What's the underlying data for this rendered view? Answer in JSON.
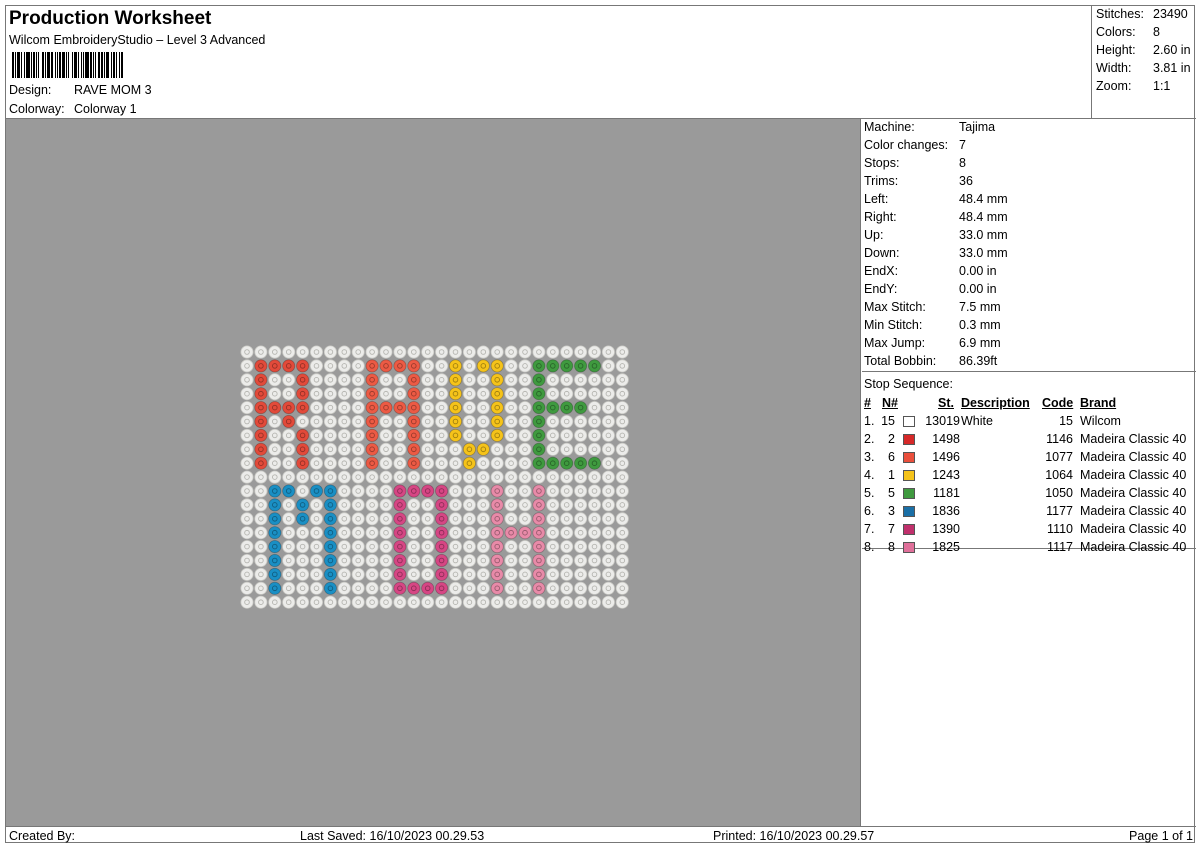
{
  "header": {
    "title": "Production Worksheet",
    "subtitle": "Wilcom EmbroideryStudio – Level 3 Advanced",
    "design_label": "Design:",
    "design_value": "RAVE MOM 3",
    "colorway_label": "Colorway:",
    "colorway_value": "Colorway 1"
  },
  "summary": [
    {
      "label": "Stitches:",
      "value": "23490"
    },
    {
      "label": "Colors:",
      "value": "8"
    },
    {
      "label": "Height:",
      "value": "2.60 in"
    },
    {
      "label": "Width:",
      "value": "3.81 in"
    },
    {
      "label": "Zoom:",
      "value": "1:1"
    }
  ],
  "machine_info": [
    {
      "label": "Machine:",
      "value": "Tajima"
    },
    {
      "label": "Color changes:",
      "value": "7"
    },
    {
      "label": "Stops:",
      "value": "8"
    },
    {
      "label": "Trims:",
      "value": "36"
    },
    {
      "label": "Left:",
      "value": "48.4 mm"
    },
    {
      "label": "Right:",
      "value": "48.4 mm"
    },
    {
      "label": "Up:",
      "value": "33.0 mm"
    },
    {
      "label": "Down:",
      "value": "33.0 mm"
    },
    {
      "label": "EndX:",
      "value": "0.00 in"
    },
    {
      "label": "EndY:",
      "value": "0.00 in"
    },
    {
      "label": "Max Stitch:",
      "value": "7.5 mm"
    },
    {
      "label": "Min Stitch:",
      "value": "0.3 mm"
    },
    {
      "label": "Max Jump:",
      "value": "6.9 mm"
    },
    {
      "label": "Total Bobbin:",
      "value": "86.39ft"
    }
  ],
  "stop_sequence": {
    "title": "Stop Sequence:",
    "headers": {
      "index": "#",
      "needle": "N#",
      "stitches": "St.",
      "description": "Description",
      "code": "Code",
      "brand": "Brand"
    },
    "rows": [
      {
        "index": "1.",
        "needle": "15",
        "color": "#ffffff",
        "stitches": "13019",
        "description": "White",
        "code": "15",
        "brand": "Wilcom"
      },
      {
        "index": "2.",
        "needle": "2",
        "color": "#d62828",
        "stitches": "1498",
        "description": "",
        "code": "1146",
        "brand": "Madeira Classic 40"
      },
      {
        "index": "3.",
        "needle": "6",
        "color": "#ea4f3c",
        "stitches": "1496",
        "description": "",
        "code": "1077",
        "brand": "Madeira Classic 40"
      },
      {
        "index": "4.",
        "needle": "1",
        "color": "#f5c31a",
        "stitches": "1243",
        "description": "",
        "code": "1064",
        "brand": "Madeira Classic 40"
      },
      {
        "index": "5.",
        "needle": "5",
        "color": "#3f9a3f",
        "stitches": "1181",
        "description": "",
        "code": "1050",
        "brand": "Madeira Classic 40"
      },
      {
        "index": "6.",
        "needle": "3",
        "color": "#1a6fa6",
        "stitches": "1836",
        "description": "",
        "code": "1177",
        "brand": "Madeira Classic 40"
      },
      {
        "index": "7.",
        "needle": "7",
        "color": "#c0306c",
        "stitches": "1390",
        "description": "",
        "code": "1110",
        "brand": "Madeira Classic 40"
      },
      {
        "index": "8.",
        "needle": "8",
        "color": "#e0709a",
        "stitches": "1825",
        "description": "",
        "code": "1117",
        "brand": "Madeira Classic 40"
      }
    ]
  },
  "footer": {
    "created_by": "Created By:",
    "last_saved": "Last Saved: 16/10/2023 00.29.53",
    "printed": "Printed: 16/10/2023 00.29.57",
    "page": "Page 1 of 1"
  },
  "design_colors": {
    "background": "#9a9a9a",
    "white": "#ececea",
    "r_letter": "#e24a3a",
    "a_letter": "#ec5a44",
    "v_letter": "#f5c31a",
    "e_letter": "#3f9a3f",
    "m1_letter": "#1a8fc4",
    "o_letter": "#d64684",
    "m2_letter": "#e88aa8"
  }
}
